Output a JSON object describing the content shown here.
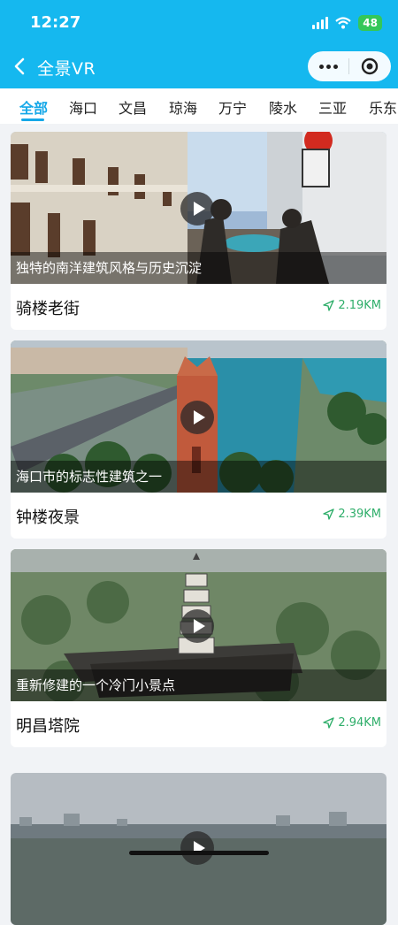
{
  "status": {
    "time": "12:27",
    "battery": "48"
  },
  "nav": {
    "title": "全景VR"
  },
  "tabs": [
    "全部",
    "海口",
    "文昌",
    "琼海",
    "万宁",
    "陵水",
    "三亚",
    "乐东"
  ],
  "spots": [
    {
      "caption": "独特的南洋建筑风格与历史沉淀",
      "name": "骑楼老街",
      "distance": "2.19KM"
    },
    {
      "caption": "海口市的标志性建筑之一",
      "name": "钟楼夜景",
      "distance": "2.39KM"
    },
    {
      "caption": "重新修建的一个冷门小景点",
      "name": "明昌塔院",
      "distance": "2.94KM"
    },
    {
      "caption": "",
      "name": "",
      "distance": ""
    }
  ],
  "colors": {
    "header": "#15b8ef",
    "active_tab": "#15a8e8",
    "distance": "#2fae6a"
  },
  "icons": [
    "back-icon",
    "more-icon",
    "record-icon",
    "play-icon",
    "location-arrow-icon"
  ]
}
